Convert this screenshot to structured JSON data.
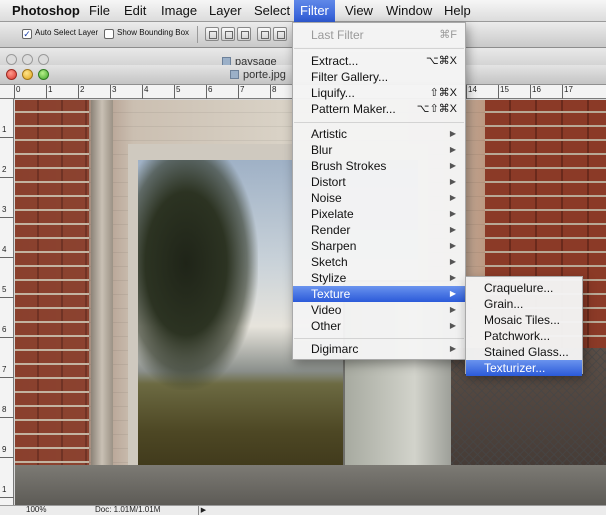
{
  "menubar": {
    "app": "Photoshop",
    "items": [
      "File",
      "Edit",
      "Image",
      "Layer",
      "Select",
      "Filter",
      "View",
      "Window",
      "Help"
    ],
    "active": "Filter"
  },
  "options": {
    "auto_select": "Auto Select Layer",
    "auto_select_checked": true,
    "bounding_box": "Show Bounding Box",
    "bounding_box_checked": false
  },
  "windows": {
    "back_title": "paysage",
    "front_title": "porte.jpg"
  },
  "ruler": {
    "labels": [
      "0",
      "1",
      "2",
      "3",
      "4",
      "5",
      "6",
      "7",
      "8",
      "14",
      "15",
      "16",
      "17"
    ],
    "vertical_labels": [
      "1",
      "2",
      "3",
      "4",
      "5",
      "6",
      "7",
      "8",
      "9",
      "1"
    ]
  },
  "filter_menu": {
    "last_filter": {
      "label": "Last Filter",
      "shortcut": "⌘F",
      "enabled": false
    },
    "group1": [
      {
        "label": "Extract...",
        "shortcut": "⌥⌘X"
      },
      {
        "label": "Filter Gallery...",
        "shortcut": ""
      },
      {
        "label": "Liquify...",
        "shortcut": "⇧⌘X"
      },
      {
        "label": "Pattern Maker...",
        "shortcut": "⌥⇧⌘X"
      }
    ],
    "group2": [
      {
        "label": "Artistic"
      },
      {
        "label": "Blur"
      },
      {
        "label": "Brush Strokes"
      },
      {
        "label": "Distort"
      },
      {
        "label": "Noise"
      },
      {
        "label": "Pixelate"
      },
      {
        "label": "Render"
      },
      {
        "label": "Sharpen"
      },
      {
        "label": "Sketch"
      },
      {
        "label": "Stylize"
      },
      {
        "label": "Texture",
        "highlighted": true
      },
      {
        "label": "Video"
      },
      {
        "label": "Other"
      }
    ],
    "group3": [
      {
        "label": "Digimarc"
      }
    ]
  },
  "texture_submenu": {
    "items": [
      "Craquelure...",
      "Grain...",
      "Mosaic Tiles...",
      "Patchwork...",
      "Stained Glass...",
      "Texturizer..."
    ],
    "highlighted": "Texturizer..."
  },
  "status": {
    "zoom": "100%",
    "doc": "Doc: 1.01M/1.01M"
  },
  "colors": {
    "menu_highlight": "#2b5ad9",
    "menubar_bg": "#dcdcdc"
  }
}
